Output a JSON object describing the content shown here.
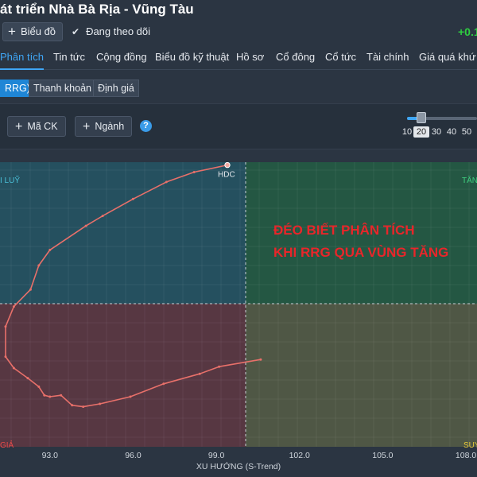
{
  "header": {
    "title": "át triển Nhà Bà Rịa - Vũng Tàu",
    "chart_button": "Biểu đồ",
    "follow_label": "Đang theo dõi",
    "change_value": "+0.1"
  },
  "tabs": [
    {
      "label": "Phân tích",
      "active": true
    },
    {
      "label": "Tin tức"
    },
    {
      "label": "Cộng đồng"
    },
    {
      "label": "Biểu đồ kỹ thuật"
    },
    {
      "label": "Hồ sơ"
    },
    {
      "label": "Cổ đông"
    },
    {
      "label": "Cổ tức"
    },
    {
      "label": "Tài chính"
    },
    {
      "label": "Giá quá khứ"
    }
  ],
  "subtabs": [
    {
      "label": "RRG)",
      "active": true
    },
    {
      "label": "Thanh khoản"
    },
    {
      "label": "Định giá"
    }
  ],
  "toolbar": {
    "add_ticker": "Mã CK",
    "add_sector": "Ngành",
    "help": "?",
    "period_options": [
      "10",
      "20",
      "30",
      "40",
      "50"
    ],
    "period_selected": "20"
  },
  "colors": {
    "accent": "#3fa6f5",
    "positive": "#2ecc40",
    "annotation": "#e8262a",
    "trail": "#e8706a"
  },
  "annotation": {
    "line1": "ĐÉO BIẾT PHÂN TÍCH",
    "line2": "KHI RRG QUA VÙNG TĂNG"
  },
  "chart_data": {
    "type": "scatter",
    "xlabel": "XU HƯỚNG (S-Trend)",
    "x_ticks": [
      "93.0",
      "96.0",
      "99.0",
      "102.0",
      "105.0",
      "108.0"
    ],
    "xlim": [
      91.2,
      108.4
    ],
    "ylim": [
      -1,
      1
    ],
    "quadrants": {
      "top_left": "I LUỸ",
      "top_right": "TĂNG",
      "bottom_left": "GIẢ",
      "bottom_right": "SUY"
    },
    "series": [
      {
        "name": "HDC",
        "x": [
          100.6,
          99.1,
          98.4,
          97.1,
          95.9,
          94.8,
          94.2,
          93.8,
          93.4,
          93.0,
          92.8,
          92.6,
          92.2,
          91.7,
          91.4,
          91.4,
          91.7,
          92.3,
          92.6,
          93.0,
          94.3,
          94.9,
          96.0,
          97.2,
          98.2,
          99.4
        ],
        "y": [
          -0.39,
          -0.44,
          -0.49,
          -0.56,
          -0.65,
          -0.7,
          -0.72,
          -0.71,
          -0.64,
          -0.65,
          -0.64,
          -0.58,
          -0.52,
          -0.45,
          -0.37,
          -0.16,
          -0.02,
          0.1,
          0.27,
          0.38,
          0.55,
          0.62,
          0.74,
          0.86,
          0.93,
          0.98
        ]
      }
    ]
  }
}
